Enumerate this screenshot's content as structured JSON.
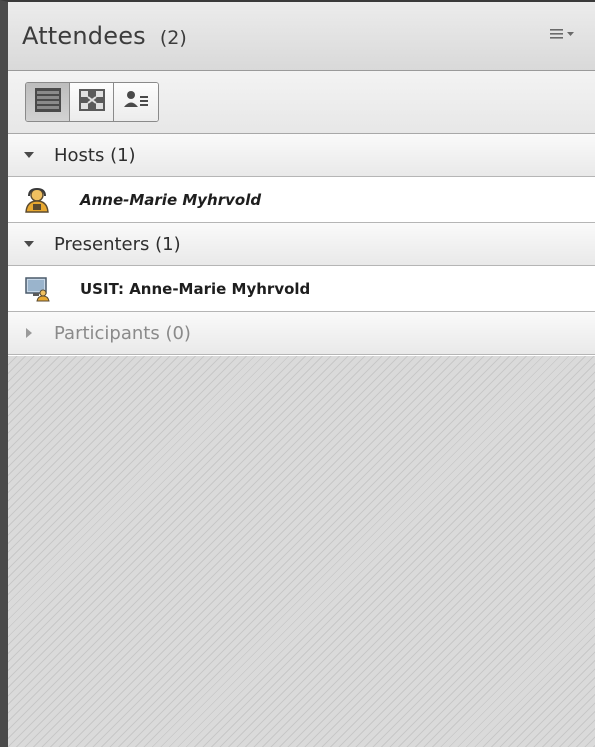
{
  "header": {
    "title": "Attendees",
    "count": "(2)",
    "menu_icon": "list-menu-icon"
  },
  "toolbar": {
    "buttons": [
      {
        "icon": "list-view-icon",
        "active": true
      },
      {
        "icon": "breakout-view-icon",
        "active": false
      },
      {
        "icon": "attendee-details-icon",
        "active": false
      }
    ]
  },
  "sections": {
    "hosts": {
      "label": "Hosts (1)",
      "expanded": true,
      "members": [
        {
          "name": "Anne-Marie Myhrvold",
          "icon": "host-icon"
        }
      ]
    },
    "presenters": {
      "label": "Presenters (1)",
      "expanded": true,
      "members": [
        {
          "name": "USIT: Anne-Marie Myhrvold",
          "icon": "presenter-icon"
        }
      ]
    },
    "participants": {
      "label": "Participants (0)",
      "expanded": false
    }
  },
  "colors": {
    "title_text": "#3c3c3c",
    "host_icon": "#e0a030",
    "empty_pattern": "#d0d0d0"
  }
}
